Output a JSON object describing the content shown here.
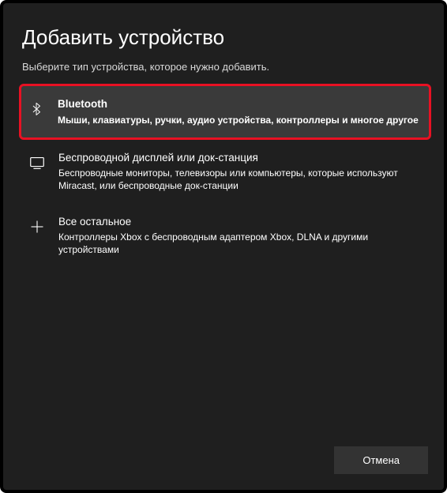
{
  "dialog": {
    "title": "Добавить устройство",
    "subtitle": "Выберите тип устройства, которое нужно добавить."
  },
  "options": {
    "bluetooth": {
      "title": "Bluetooth",
      "desc": "Мыши, клавиатуры, ручки, аудио устройства, контроллеры и многое другое"
    },
    "wireless": {
      "title": "Беспроводной дисплей или док-станция",
      "desc": "Беспроводные мониторы, телевизоры или компьютеры, которые используют Miracast, или беспроводные док-станции"
    },
    "other": {
      "title": "Все остальное",
      "desc": "Контроллеры Xbox с беспроводным адаптером Xbox, DLNA и другими устройствами"
    }
  },
  "footer": {
    "cancel": "Отмена"
  }
}
